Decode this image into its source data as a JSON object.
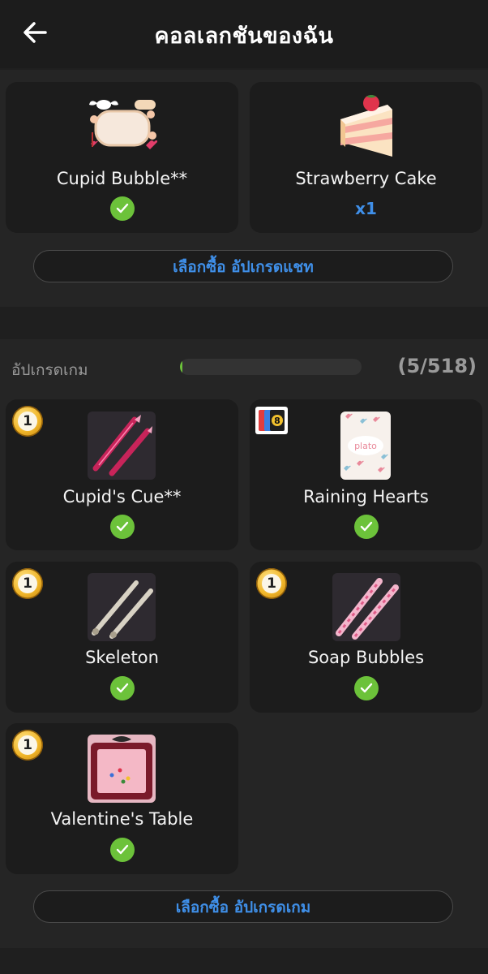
{
  "header": {
    "title": "คอลเลกชันของฉัน"
  },
  "chat_section": {
    "items": [
      {
        "name": "Cupid Bubble**",
        "owned": true
      },
      {
        "name": "Strawberry Cake",
        "quantity": "x1"
      }
    ],
    "buy_button": "เลือกซื้อ อัปเกรดแชท"
  },
  "game_section": {
    "label": "อัปเกรดเกม",
    "progress_text": "(5/518)",
    "progress": 0.0097,
    "items": [
      {
        "name": "Cupid's Cue**",
        "badge": "1",
        "owned": true
      },
      {
        "name": "Raining Hearts",
        "badge_icon": "uno-cards-icon",
        "owned": true
      },
      {
        "name": "Skeleton",
        "badge": "1",
        "owned": true
      },
      {
        "name": "Soap Bubbles",
        "badge": "1",
        "owned": true
      },
      {
        "name": "Valentine's Table",
        "badge": "1",
        "owned": true
      }
    ],
    "buy_button": "เลือกซื้อ อัปเกรดเกม"
  },
  "colors": {
    "background": "#1f1f1f",
    "card": "#1c1c1c",
    "accent_blue": "#3f8fe8",
    "check_green": "#6cc23a"
  }
}
